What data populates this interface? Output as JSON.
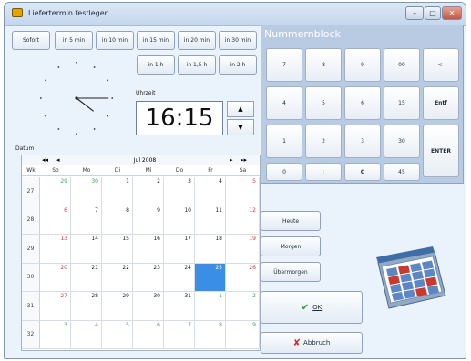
{
  "window": {
    "title": "Liefertermin festlegen",
    "controls": [
      "–",
      "□",
      "✕"
    ]
  },
  "quick": {
    "row1": [
      "Sofort",
      "in 5 min",
      "in 10 min",
      "in 15 min",
      "in 20 min",
      "in 30 min"
    ],
    "row2": [
      "in 1 h",
      "in 1,5 h",
      "in 2 h"
    ]
  },
  "time": {
    "label": "Uhrzeit",
    "value": "16:15",
    "up": "▲",
    "down": "▼",
    "hour": 16,
    "minute": 15
  },
  "numpad": {
    "title": "Nummernblock",
    "keys": [
      [
        "7",
        "8",
        "9",
        "00",
        "<-"
      ],
      [
        "4",
        "5",
        "6",
        "15",
        "Entf"
      ],
      [
        "1",
        "2",
        "3",
        "30"
      ],
      [
        "0",
        ":",
        "C",
        "45"
      ]
    ],
    "enter": "ENTER"
  },
  "calendar": {
    "label": "Datum",
    "month": "Jul 2008",
    "nav": {
      "prev_year": "◂◂",
      "prev": "◂",
      "next": "▸",
      "next_year": "▸▸"
    },
    "headers": [
      "Wk",
      "So",
      "Mo",
      "Di",
      "Mi",
      "Do",
      "Fr",
      "Sa"
    ],
    "weeks": [
      {
        "wk": "27",
        "days": [
          "29",
          "30",
          "1",
          "2",
          "3",
          "4",
          "5"
        ]
      },
      {
        "wk": "28",
        "days": [
          "6",
          "7",
          "8",
          "9",
          "10",
          "11",
          "12"
        ]
      },
      {
        "wk": "29",
        "days": [
          "13",
          "14",
          "15",
          "16",
          "17",
          "18",
          "19"
        ]
      },
      {
        "wk": "30",
        "days": [
          "20",
          "21",
          "22",
          "23",
          "24",
          "25",
          "26"
        ]
      },
      {
        "wk": "31",
        "days": [
          "27",
          "28",
          "29",
          "30",
          "31",
          "1",
          "2"
        ]
      },
      {
        "wk": "32",
        "days": [
          "3",
          "4",
          "5",
          "6",
          "7",
          "8",
          "9"
        ]
      }
    ],
    "selected": "25",
    "colors": {
      "sunday": "#d23a3a",
      "saturday": "#d23a3a",
      "other_month": "#3aa64a",
      "selected": "#3b8ee6"
    }
  },
  "shortcuts": [
    "Heute",
    "Morgen",
    "Übermorgen"
  ],
  "actions": {
    "ok": "OK",
    "cancel": "Abbruch"
  },
  "icons": {
    "app": "app-icon",
    "ok": "check-icon",
    "cancel": "x-icon",
    "calendar": "calendar-illustration-icon"
  }
}
